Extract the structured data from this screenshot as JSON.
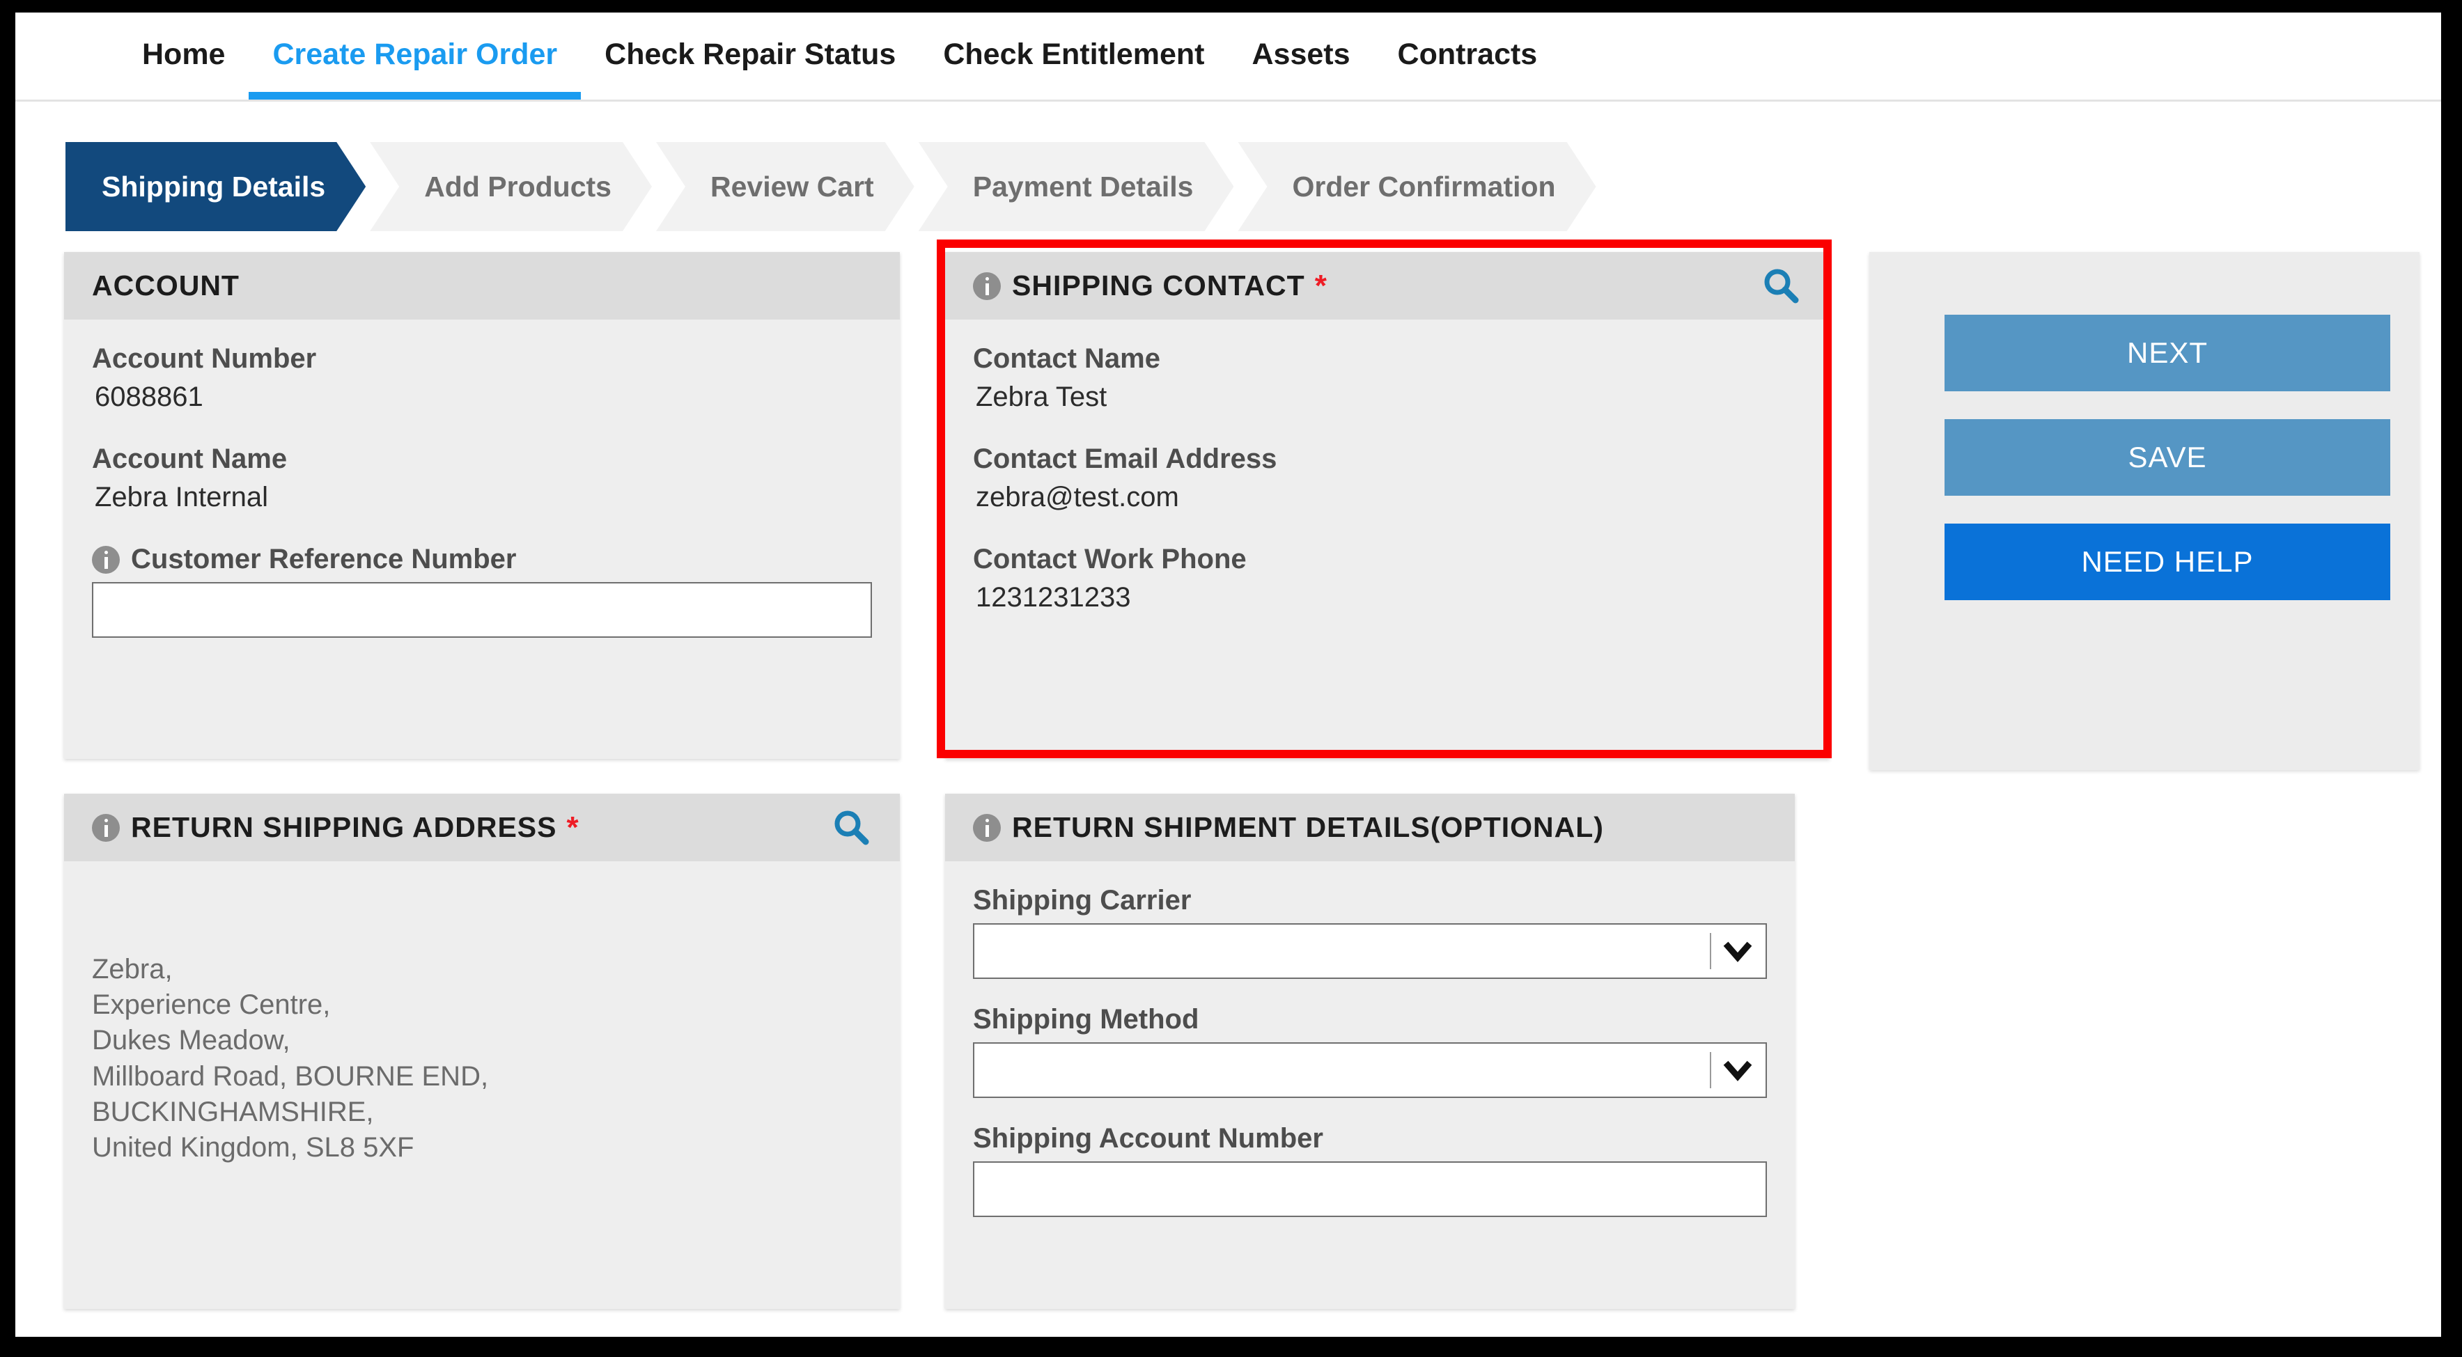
{
  "colors": {
    "nav_active": "#1a9bf0",
    "step_active_bg": "#12497d",
    "required_star": "#ee1c25",
    "search_icon": "#1b7fb5",
    "btn_secondary": "#5596c4",
    "btn_primary": "#0a72d8",
    "highlight_box": "#fb0000"
  },
  "nav": {
    "items": [
      {
        "label": "Home",
        "active": false
      },
      {
        "label": "Create Repair Order",
        "active": true
      },
      {
        "label": "Check Repair Status",
        "active": false
      },
      {
        "label": "Check Entitlement",
        "active": false
      },
      {
        "label": "Assets",
        "active": false
      },
      {
        "label": "Contracts",
        "active": false
      }
    ]
  },
  "stepper": {
    "steps": [
      {
        "label": "Shipping Details",
        "active": true
      },
      {
        "label": "Add Products",
        "active": false
      },
      {
        "label": "Review Cart",
        "active": false
      },
      {
        "label": "Payment Details",
        "active": false
      },
      {
        "label": "Order Confirmation",
        "active": false
      }
    ]
  },
  "account_card": {
    "title": "ACCOUNT",
    "account_number_label": "Account Number",
    "account_number_value": "6088861",
    "account_name_label": "Account Name",
    "account_name_value": "Zebra Internal",
    "customer_reference_label": "Customer Reference Number",
    "customer_reference_value": "",
    "customer_reference_placeholder": ""
  },
  "shipping_contact_card": {
    "title": "SHIPPING CONTACT",
    "required_marker": "*",
    "contact_name_label": "Contact Name",
    "contact_name_value": "Zebra Test",
    "contact_email_label": "Contact Email Address",
    "contact_email_value": "zebra@test.com",
    "contact_phone_label": "Contact Work Phone",
    "contact_phone_value": "1231231233",
    "search_icon": "search-icon",
    "info_icon": "info-icon"
  },
  "return_shipping_address_card": {
    "title": "RETURN SHIPPING ADDRESS",
    "required_marker": "*",
    "address_lines": [
      "Zebra,",
      "Experience Centre,",
      "Dukes Meadow,",
      "Millboard Road, BOURNE END,",
      "BUCKINGHAMSHIRE,",
      "United Kingdom, SL8 5XF"
    ],
    "search_icon": "search-icon",
    "info_icon": "info-icon"
  },
  "return_shipment_details_card": {
    "title": "RETURN SHIPMENT DETAILS(OPTIONAL)",
    "info_icon": "info-icon",
    "shipping_carrier_label": "Shipping Carrier",
    "shipping_carrier_value": "",
    "shipping_method_label": "Shipping Method",
    "shipping_method_value": "",
    "shipping_account_number_label": "Shipping Account Number",
    "shipping_account_number_value": "",
    "shipping_account_number_placeholder": ""
  },
  "actions": {
    "next_label": "NEXT",
    "save_label": "SAVE",
    "help_label": "NEED HELP"
  }
}
